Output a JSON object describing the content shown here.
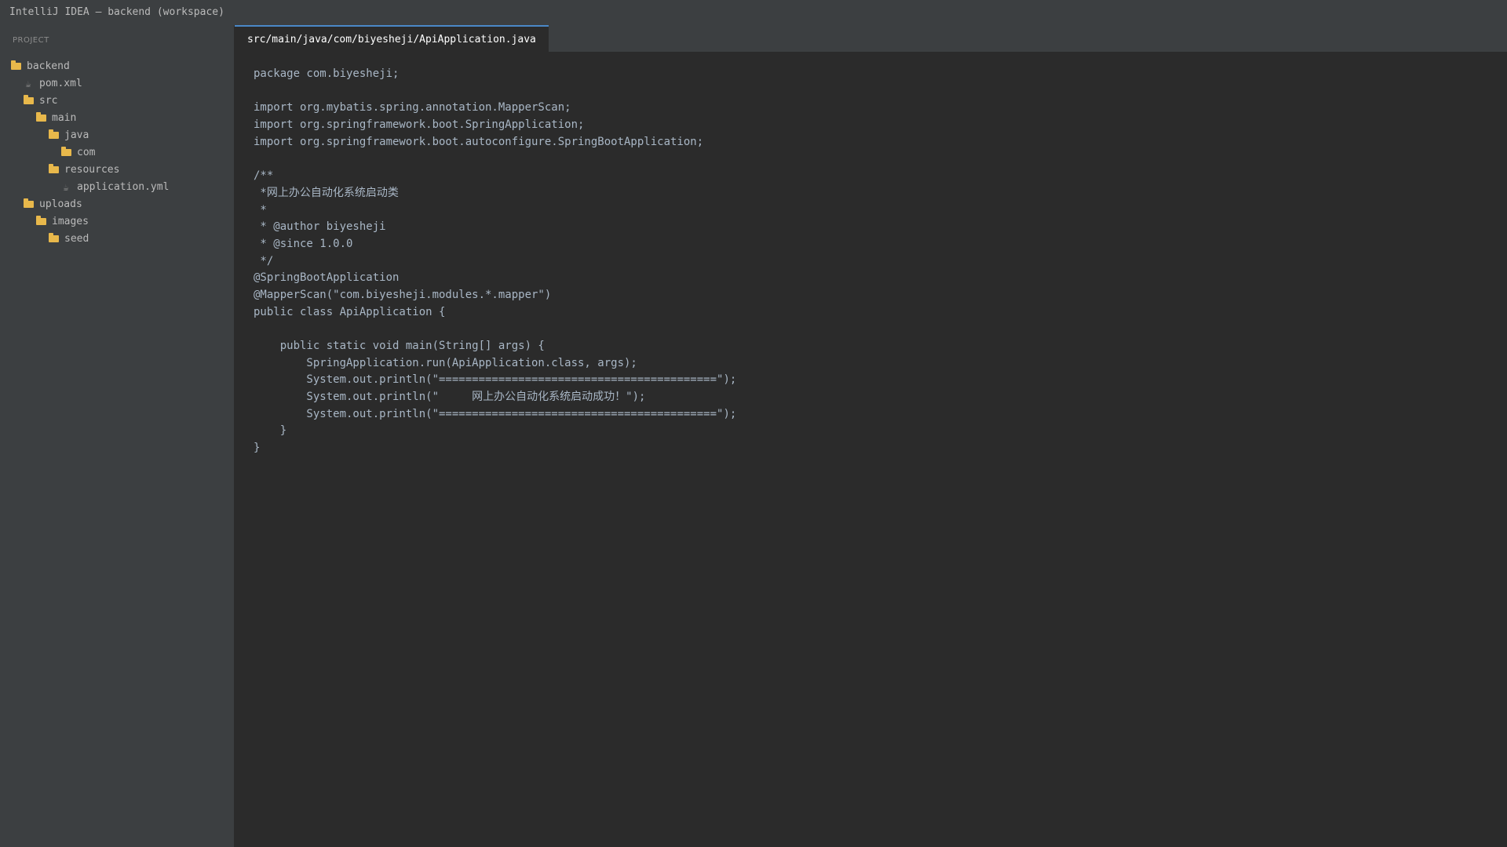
{
  "window": {
    "title": "IntelliJ IDEA — backend (workspace)"
  },
  "sidebar": {
    "header": "PROJECT",
    "tree": [
      {
        "label": "backend",
        "type": "folder",
        "depth": 0
      },
      {
        "label": "pom.xml",
        "type": "file",
        "depth": 1
      },
      {
        "label": "src",
        "type": "folder",
        "depth": 1
      },
      {
        "label": "main",
        "type": "folder",
        "depth": 2
      },
      {
        "label": "java",
        "type": "folder",
        "depth": 3
      },
      {
        "label": "com",
        "type": "folder",
        "depth": 4
      },
      {
        "label": "resources",
        "type": "folder",
        "depth": 3
      },
      {
        "label": "application.yml",
        "type": "file",
        "depth": 4
      },
      {
        "label": "uploads",
        "type": "folder",
        "depth": 1
      },
      {
        "label": "images",
        "type": "folder",
        "depth": 2
      },
      {
        "label": "seed",
        "type": "folder",
        "depth": 3
      }
    ]
  },
  "editor": {
    "tabs": [
      {
        "label": "src/main/java/com/biyesheji/ApiApplication.java",
        "active": true
      }
    ],
    "lines": [
      "package com.biyesheji;",
      "",
      "import org.mybatis.spring.annotation.MapperScan;",
      "import org.springframework.boot.SpringApplication;",
      "import org.springframework.boot.autoconfigure.SpringBootApplication;",
      "",
      "/**",
      " *网上办公自动化系统启动类",
      " *",
      " * @author biyesheji",
      " * @since 1.0.0",
      " */",
      "@SpringBootApplication",
      "@MapperScan(\"com.biyesheji.modules.*.mapper\")",
      "public class ApiApplication {",
      "",
      "    public static void main(String[] args) {",
      "        SpringApplication.run(ApiApplication.class, args);",
      "        System.out.println(\"==========================================\");",
      "        System.out.println(\"     网上办公自动化系统启动成功！\");",
      "        System.out.println(\"==========================================\");",
      "    }",
      "}"
    ]
  },
  "colors": {
    "titlebar_bg": "#3c3f41",
    "sidebar_bg": "#3c3f41",
    "editor_bg": "#2b2b2b",
    "code_text": "#a9b7c6",
    "tab_accent": "#4a88c7",
    "folder_icon": "#e8b84b"
  }
}
